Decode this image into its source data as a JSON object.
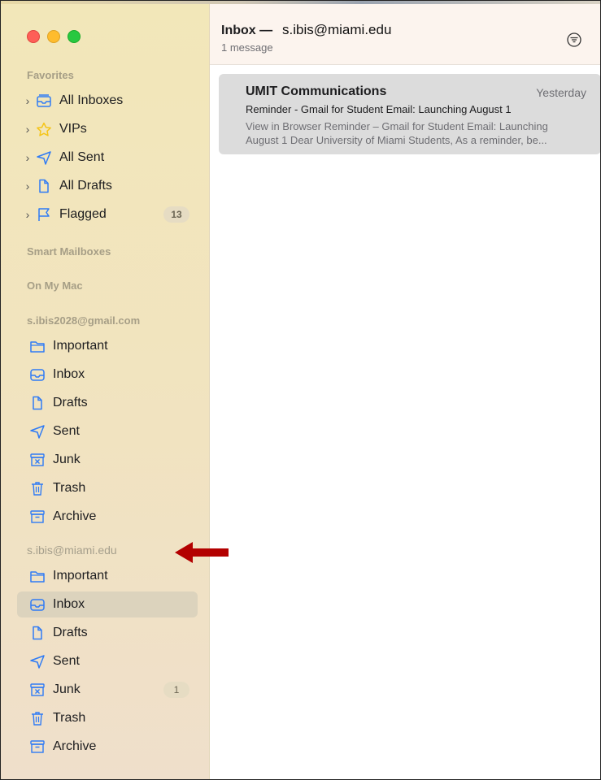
{
  "window": {
    "favorites_label": "Favorites",
    "smart_mailboxes_label": "Smart Mailboxes",
    "on_my_mac_label": "On My Mac"
  },
  "favorites": [
    {
      "label": "All Inboxes",
      "icon": "inbox-stack-icon"
    },
    {
      "label": "VIPs",
      "icon": "star-icon"
    },
    {
      "label": "All Sent",
      "icon": "paper-plane-icon"
    },
    {
      "label": "All Drafts",
      "icon": "document-icon"
    },
    {
      "label": "Flagged",
      "icon": "flag-icon",
      "badge": "13"
    }
  ],
  "accounts": [
    {
      "name": "s.ibis2028@gmail.com",
      "folders": [
        {
          "label": "Important",
          "icon": "folder-icon"
        },
        {
          "label": "Inbox",
          "icon": "inbox-icon"
        },
        {
          "label": "Drafts",
          "icon": "document-icon"
        },
        {
          "label": "Sent",
          "icon": "paper-plane-icon"
        },
        {
          "label": "Junk",
          "icon": "junk-icon"
        },
        {
          "label": "Trash",
          "icon": "trash-icon"
        },
        {
          "label": "Archive",
          "icon": "archive-icon"
        }
      ]
    },
    {
      "name": "s.ibis@miami.edu",
      "folders": [
        {
          "label": "Important",
          "icon": "folder-icon"
        },
        {
          "label": "Inbox",
          "icon": "inbox-icon",
          "selected": true
        },
        {
          "label": "Drafts",
          "icon": "document-icon"
        },
        {
          "label": "Sent",
          "icon": "paper-plane-icon"
        },
        {
          "label": "Junk",
          "icon": "junk-icon",
          "badge": "1"
        },
        {
          "label": "Trash",
          "icon": "trash-icon"
        },
        {
          "label": "Archive",
          "icon": "archive-icon"
        }
      ]
    }
  ],
  "header": {
    "title": "Inbox —",
    "email": "s.ibis@miami.edu",
    "subtitle": "1 message"
  },
  "messages": [
    {
      "sender": "UMIT Communications",
      "date": "Yesterday",
      "subject": "Reminder - Gmail for Student Email: Launching August 1",
      "preview_line1": "View in Browser Reminder – Gmail for Student Email: Launching",
      "preview_line2": "August 1 Dear University of Miami Students, As a reminder, be..."
    }
  ],
  "colors": {
    "accent": "#2f7bf5",
    "annotation_arrow": "#b30000",
    "vip_star": "#f5c518"
  }
}
